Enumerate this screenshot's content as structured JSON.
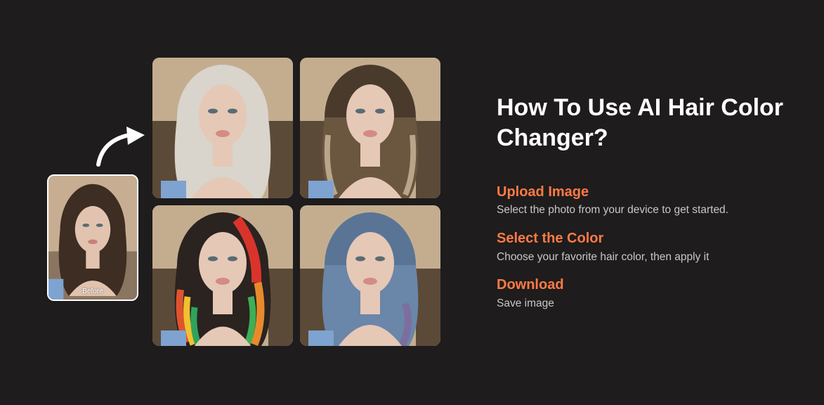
{
  "before_card": {
    "label": "Before",
    "hair_color": "#3d2d22"
  },
  "results": [
    {
      "name": "platinum",
      "hair_color": "#d9d4cc"
    },
    {
      "name": "balayage",
      "hair_color": "#6b5640"
    },
    {
      "name": "rainbow",
      "hair_color": "#2a2320"
    },
    {
      "name": "blue",
      "hair_color": "#6a86a8"
    }
  ],
  "guide": {
    "title": "How To Use AI Hair Color Changer?",
    "steps": [
      {
        "heading": "Upload Image",
        "description": "Select the photo from your device to get started."
      },
      {
        "heading": "Select the Color",
        "description": "Choose your favorite hair color, then apply it"
      },
      {
        "heading": "Download",
        "description": "Save image"
      }
    ]
  },
  "colors": {
    "background": "#1e1c1c",
    "accent": "#ff7a45",
    "title": "#ffffff",
    "description": "#c8c8c8"
  }
}
